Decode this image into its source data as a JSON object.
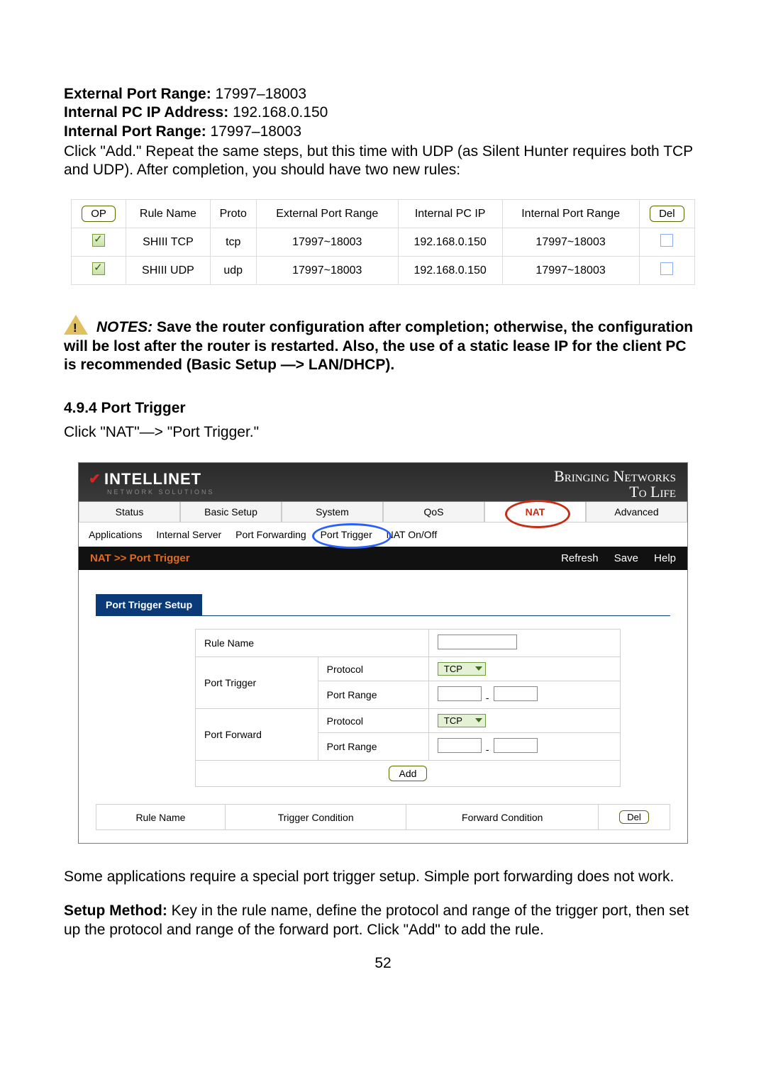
{
  "intro": {
    "kv1_label": "External Port Range:",
    "kv1_value": " 17997–18003",
    "kv2_label": "Internal PC IP Address:",
    "kv2_value": " 192.168.0.150",
    "kv3_label": "Internal Port Range:",
    "kv3_value": " 17997–18003",
    "after": "Click \"Add.\"  Repeat the same steps, but this time with UDP (as Silent Hunter requires both TCP and UDP). After completion, you should have two new rules:"
  },
  "rules": {
    "headers": {
      "op": "OP",
      "name": "Rule Name",
      "proto": "Proto",
      "ext": "External Port Range",
      "ip": "Internal PC IP",
      "int": "Internal Port Range",
      "del": "Del"
    },
    "rows": [
      {
        "name": "SHIII TCP",
        "proto": "tcp",
        "ext": "17997~18003",
        "ip": "192.168.0.150",
        "int": "17997~18003"
      },
      {
        "name": "SHIII UDP",
        "proto": "udp",
        "ext": "17997~18003",
        "ip": "192.168.0.150",
        "int": "17997~18003"
      }
    ]
  },
  "notes": {
    "label": "NOTES:",
    "text": "  Save the router configuration after completion; otherwise, the configuration will be lost after the router is restarted. Also, the use of a static lease IP for the client PC is recommended (Basic Setup —> LAN/DHCP)."
  },
  "sect_heading": "4.9.4 Port Trigger",
  "sect_after": "Click \"NAT\"—> \"Port Trigger.\"",
  "router": {
    "logo": "INTELLINET",
    "logo_sub": "NETWORK SOLUTIONS",
    "slogan1": "Bringing Networks",
    "slogan2": "To Life",
    "tabs": {
      "status": "Status",
      "basic": "Basic Setup",
      "system": "System",
      "qos": "QoS",
      "nat": "NAT",
      "advanced": "Advanced"
    },
    "subnav": {
      "a": "Applications",
      "b": "Internal Server",
      "c": "Port Forwarding",
      "d": "Port Trigger",
      "e": "NAT On/Off"
    },
    "breadcrumb": "NAT >> Port Trigger",
    "btn_refresh": "Refresh",
    "btn_save": "Save",
    "btn_help": "Help",
    "panel_title": "Port Trigger Setup",
    "form": {
      "rulename": "Rule Name",
      "porttrigger": "Port Trigger",
      "portforward": "Port Forward",
      "protocol": "Protocol",
      "portrange": "Port Range",
      "tcp": "TCP",
      "add": "Add"
    },
    "result": {
      "rn": "Rule Name",
      "tc": "Trigger Condition",
      "fc": "Forward Condition",
      "del": "Del"
    }
  },
  "after_router": {
    "p1": "Some applications require a special port trigger setup. Simple port forwarding does not work.",
    "sm_label": "Setup Method:",
    "sm_text": " Key in the rule name, define the protocol and range of the trigger port, then set up the protocol and range of the forward port. Click \"Add\" to add the rule."
  },
  "pageno": "52"
}
